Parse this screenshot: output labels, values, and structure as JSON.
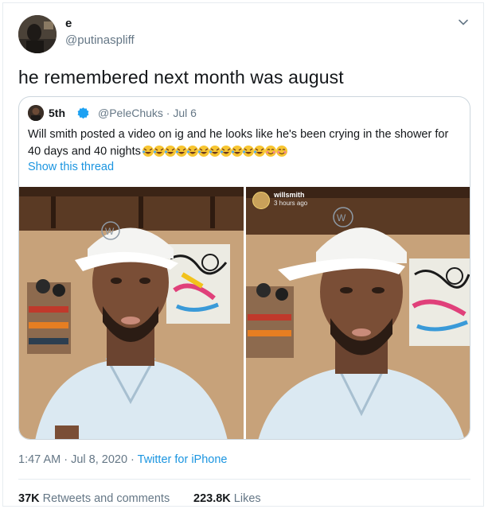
{
  "tweet": {
    "display_name": "e",
    "handle": "@putinaspliff",
    "text": "he remembered next month was august",
    "timestamp": "1:47 AM · Jul 8, 2020 · ",
    "source": "Twitter for iPhone",
    "retweets_count": "37K",
    "retweets_label": " Retweets and comments",
    "likes_count": "223.8K",
    "likes_label": " Likes",
    "menu_icon": "chevron-down-icon"
  },
  "quoted_tweet": {
    "display_name": "5th",
    "verified_icon": "verified-badge-icon",
    "handle_date": "@PeleChuks · Jul 6",
    "text": "Will smith posted a video on ig and he looks like he's been crying in the shower for 40 days and 40 nights",
    "emoji_note": "rolling-on-floor-laughing x11, smiling-face-with-smiling-eyes x2",
    "show_thread": "Show this thread",
    "media": {
      "right_overlay_user": "willsmith",
      "right_overlay_time": "3 hours ago"
    }
  },
  "colors": {
    "link": "#1b95e0",
    "secondary_text": "#657786",
    "border": "#ccd6dd"
  }
}
